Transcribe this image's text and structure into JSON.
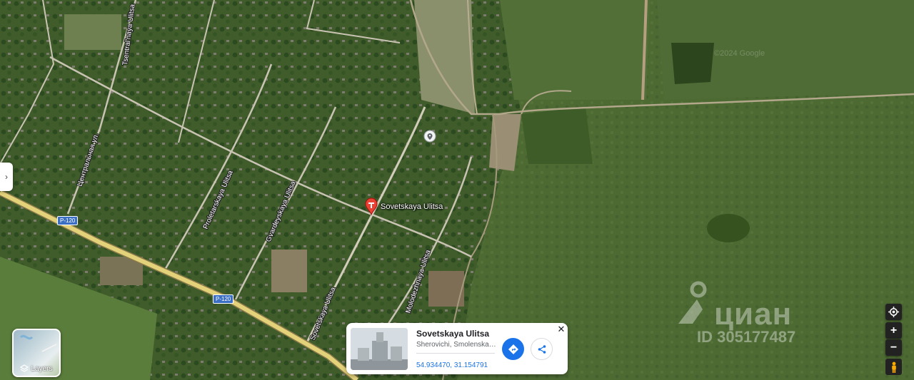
{
  "map": {
    "type": "satellite",
    "roads": [
      {
        "name": "Tsentral'naya Ulitsa"
      },
      {
        "name": "Центральная ул."
      },
      {
        "name": "Proletarskaya Ulitsa"
      },
      {
        "name": "Gvardeyskaya Ulitsa"
      },
      {
        "name": "Sovetskaya Ulitsa"
      },
      {
        "name": "Molodezhnaya Ulitsa"
      }
    ],
    "route_badges": [
      "P-120",
      "P-120"
    ],
    "pin_label": "Sovetskaya Ulitsa",
    "imagery_credit": "©2024 Google"
  },
  "watermark": {
    "brand": "циан",
    "id_text": "ID 305177487"
  },
  "controls": {
    "layers_label": "Layers",
    "zoom_in": "+",
    "zoom_out": "−",
    "left_tab_glyph": "›"
  },
  "info_card": {
    "title": "Sovetskaya Ulitsa",
    "subtitle": "Sherovichi, Smolenskay…",
    "coordinates": "54.934470, 31.154791",
    "close_glyph": "✕"
  },
  "colors": {
    "accent": "#1a73e8",
    "pin": "#ea4335",
    "control_bg": "#222222",
    "badge": "#3b6fc4"
  },
  "icons": [
    "location-pin-icon",
    "place-marker-icon",
    "layers-icon",
    "locate-me-icon",
    "pegman-icon",
    "directions-icon",
    "share-icon",
    "close-icon",
    "chevron-right-icon"
  ]
}
